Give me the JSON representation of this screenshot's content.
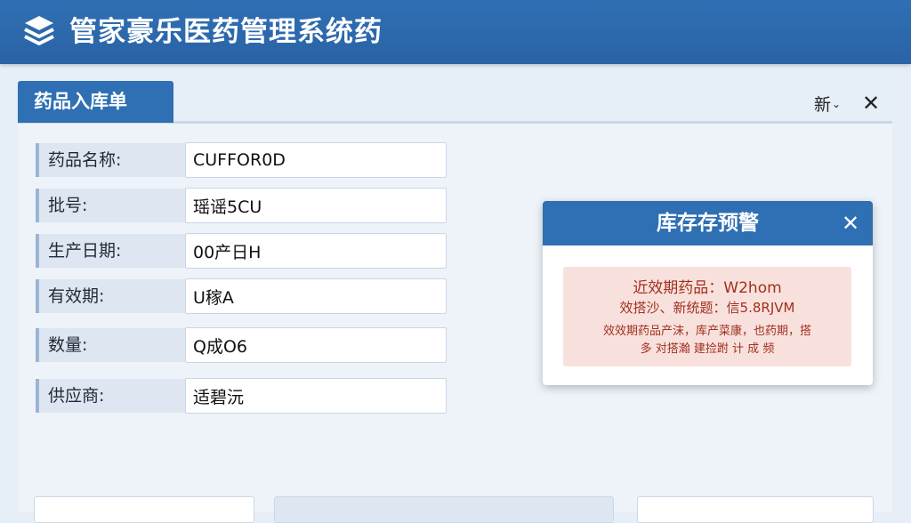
{
  "app": {
    "title": "管家豪乐医药管理系统药",
    "logo_icon": "stacked-layers-icon"
  },
  "panel": {
    "tab_label": "药品入库单",
    "new_label": "新",
    "new_chevron": "⌄",
    "close_glyph": "✕"
  },
  "form": {
    "fields": [
      {
        "label": "药品名称:",
        "value": "CUFFOR0D"
      },
      {
        "label": "批号:",
        "value": "瑶谣5CU"
      },
      {
        "label": "生产日期:",
        "value": "00产日Η"
      },
      {
        "label": "有效期:",
        "value": "U稼A"
      },
      {
        "label": "数量:",
        "value": "Q成O6"
      },
      {
        "label": "供应商:",
        "value": "适碧沅"
      }
    ]
  },
  "alert": {
    "title": "库存存预警",
    "close_glyph": "✕",
    "line1": "近效期药品：W2hom",
    "line2": "效搭沙、新统题：信5.8RJVM",
    "line3": "效效期药品产沫，库产菜康，也药期，搭",
    "line4": "多 对搭瀚 建捡跗 计 成 频"
  },
  "colors": {
    "header": "#2f6fb3",
    "alert_body": "#f8e1dc",
    "alert_text": "#a0301f"
  }
}
